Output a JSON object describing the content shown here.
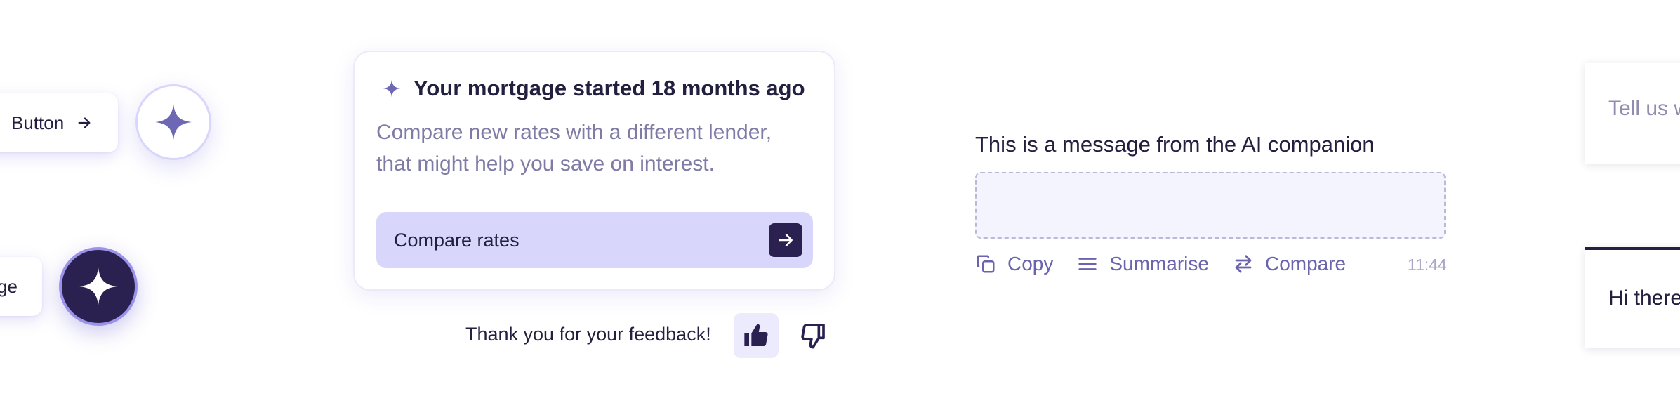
{
  "buttons": {
    "pill_button_label": "Button",
    "pill_partial_label": "ge"
  },
  "card": {
    "title": "Your mortgage started 18 months ago",
    "body": "Compare new rates with a different lender, that might help you save on interest.",
    "cta_label": "Compare rates"
  },
  "feedback": {
    "text": "Thank you for your feedback!"
  },
  "ai_message": {
    "text": "This is a message from the AI companion",
    "actions": [
      "Copy",
      "Summarise",
      "Compare"
    ],
    "timestamp": "11:44"
  },
  "side_panels": {
    "panel_1_text": "Tell us w",
    "panel_2_text": "Hi there"
  },
  "colors": {
    "accent": "#6b64ad",
    "dark": "#2b2150",
    "cta_bg": "#d9d6fb",
    "text": "#23203f"
  }
}
